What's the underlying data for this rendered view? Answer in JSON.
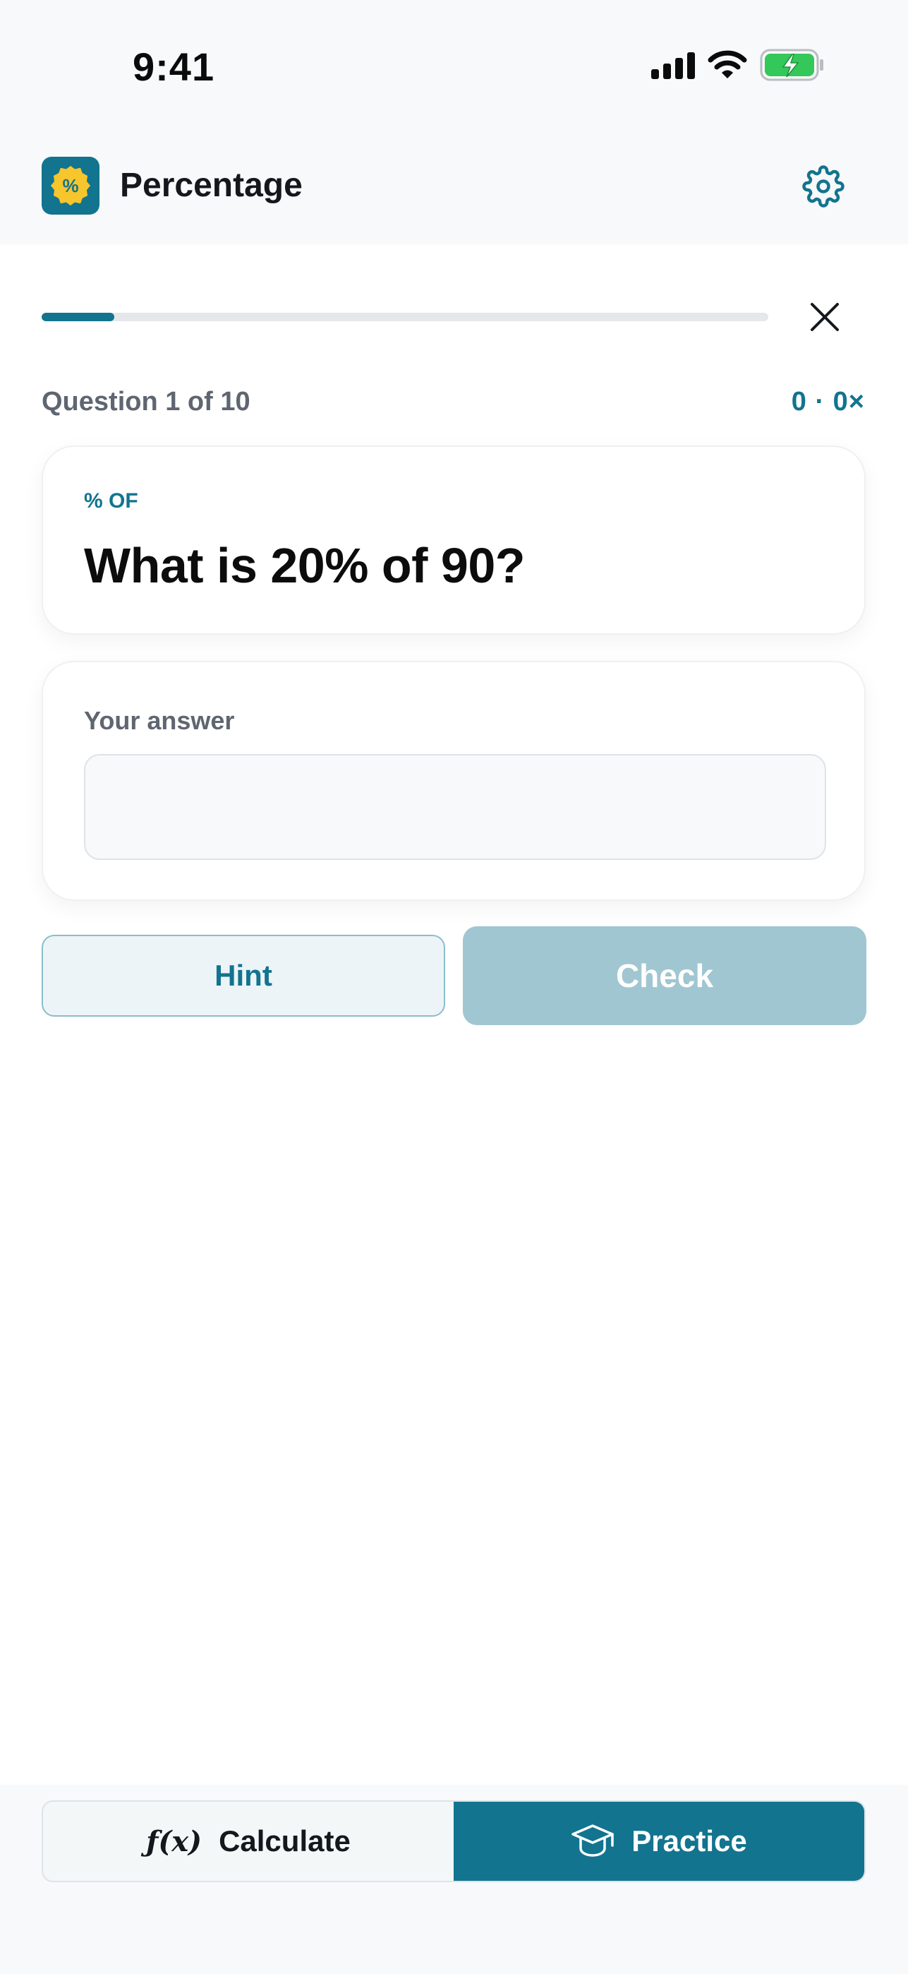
{
  "status_bar": {
    "time": "9:41",
    "icons": [
      "signal-icon",
      "wifi-icon",
      "battery-charging-icon"
    ]
  },
  "header": {
    "logo_symbol": "%",
    "title": "Percentage",
    "settings_icon": "gear-icon"
  },
  "quiz": {
    "progress_fraction": 0.1,
    "close_icon": "close-icon",
    "counter": "Question 1 of 10",
    "score": "0 · 0×",
    "question_tag": "% OF",
    "question_text": "What is 20% of 90?",
    "answer_label": "Your answer",
    "answer_value": "",
    "hint_label": "Hint",
    "check_label": "Check"
  },
  "tabs": {
    "calculate_icon_text": "ƒ(x)",
    "calculate_label": "Calculate",
    "practice_icon": "graduation-cap-icon",
    "practice_label": "Practice",
    "active": "practice"
  },
  "colors": {
    "accent": "#12748f",
    "badge": "#f7c52c",
    "check_disabled": "#a0c6d1",
    "battery": "#34c759"
  }
}
